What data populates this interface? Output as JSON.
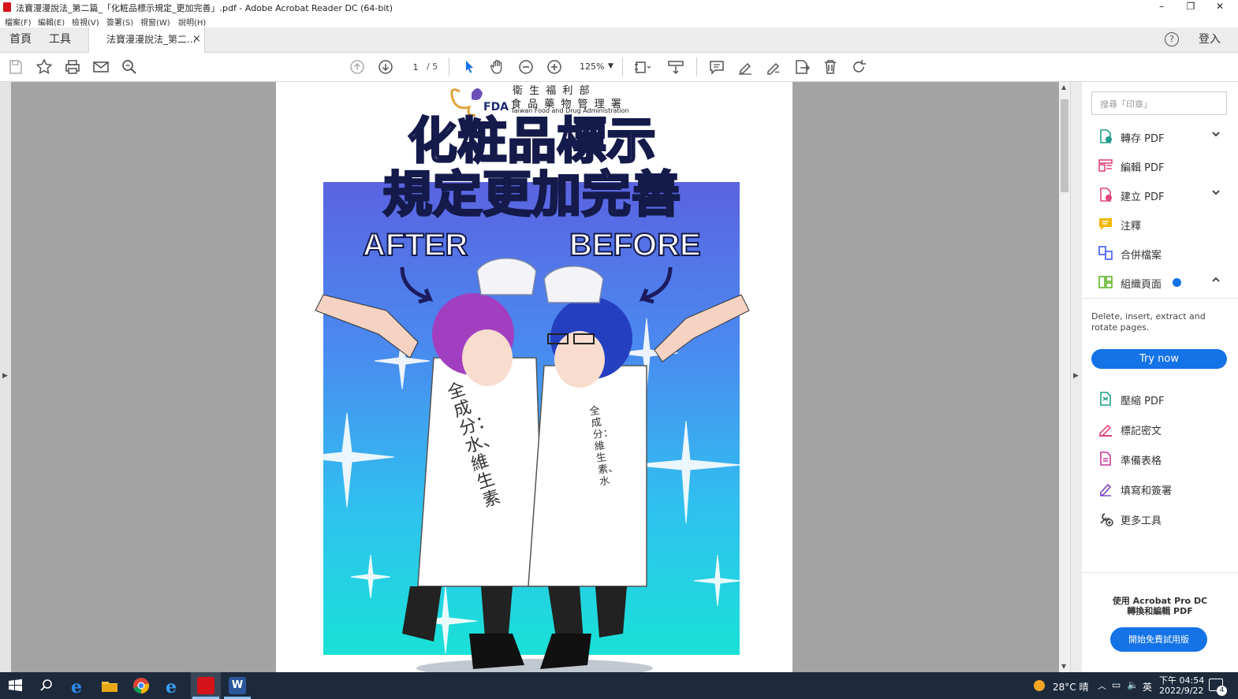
{
  "window": {
    "title": "法寶漫漫說法_第二篇_「化粧品標示規定_更加完善」.pdf - Adobe Acrobat Reader DC (64-bit)",
    "controls": {
      "minimize": "–",
      "restore": "❐",
      "close": "✕"
    }
  },
  "menu": [
    "檔案(F)",
    "編輯(E)",
    "檢視(V)",
    "簽署(S)",
    "視窗(W)",
    "說明(H)"
  ],
  "tabs": {
    "home": "首頁",
    "tools": "工具",
    "document": "法寶漫漫說法_第二...",
    "document_close": "×"
  },
  "header_right": {
    "help_icon": "?",
    "signin": "登入"
  },
  "toolbar": {
    "page_current": "1",
    "page_total": "/ 5",
    "zoom": "125%"
  },
  "poster": {
    "agency_zh_line1": "衛 生 福 利 部",
    "agency_zh_line2": "食 品 藥 物 管 理 署",
    "agency_abbr": "FDA",
    "agency_en": "Taiwan Food and Drug Administration",
    "headline_line1": "化粧品標示",
    "headline_line2": "規定更加完善",
    "after_label": "AFTER",
    "before_label": "BEFORE",
    "left_apron_text": "全成分：水、維生素",
    "right_apron_text": "全成分：維生素、水"
  },
  "right_pane": {
    "search_placeholder": "搜尋「印章」",
    "tools_top": [
      {
        "label": "轉存 PDF",
        "icon": "export-pdf-icon",
        "color": "#1f9e8a",
        "has_chevron": true
      },
      {
        "label": "編輯 PDF",
        "icon": "edit-pdf-icon",
        "color": "#e0457b",
        "has_chevron": false
      },
      {
        "label": "建立 PDF",
        "icon": "create-pdf-icon",
        "color": "#e0457b",
        "has_chevron": true
      },
      {
        "label": "注釋",
        "icon": "comment-icon",
        "color": "#f2b600",
        "has_chevron": false
      },
      {
        "label": "合併檔案",
        "icon": "combine-files-icon",
        "color": "#3d5afe",
        "has_chevron": false
      },
      {
        "label": "組織頁面",
        "icon": "organize-pages-icon",
        "color": "#5fb224",
        "has_chevron": true,
        "expanded": true
      }
    ],
    "organize_desc": "Delete, insert, extract and rotate pages.",
    "try_now": "Try now",
    "tools_bottom": [
      {
        "label": "壓縮 PDF",
        "icon": "compress-pdf-icon",
        "color": "#1f9e8a"
      },
      {
        "label": "標記密文",
        "icon": "redact-icon",
        "color": "#e0457b"
      },
      {
        "label": "準備表格",
        "icon": "prepare-form-icon",
        "color": "#c2379b"
      },
      {
        "label": "填寫和簽署",
        "icon": "fill-sign-icon",
        "color": "#7b45c4"
      },
      {
        "label": "更多工具",
        "icon": "more-tools-icon",
        "color": "#444444"
      }
    ],
    "promo_line1": "使用 Acrobat Pro DC",
    "promo_line2": "轉換和編輯 PDF",
    "promo_button": "開始免費試用版"
  },
  "taskbar": {
    "weather": "28°C 晴",
    "ime": "英",
    "time": "下午 04:54",
    "date": "2022/9/22",
    "notification_count": "4"
  },
  "colors": {
    "accent_blue": "#1473e6",
    "taskbar": "#1c2a3c",
    "acrobat_red": "#d4131a"
  }
}
